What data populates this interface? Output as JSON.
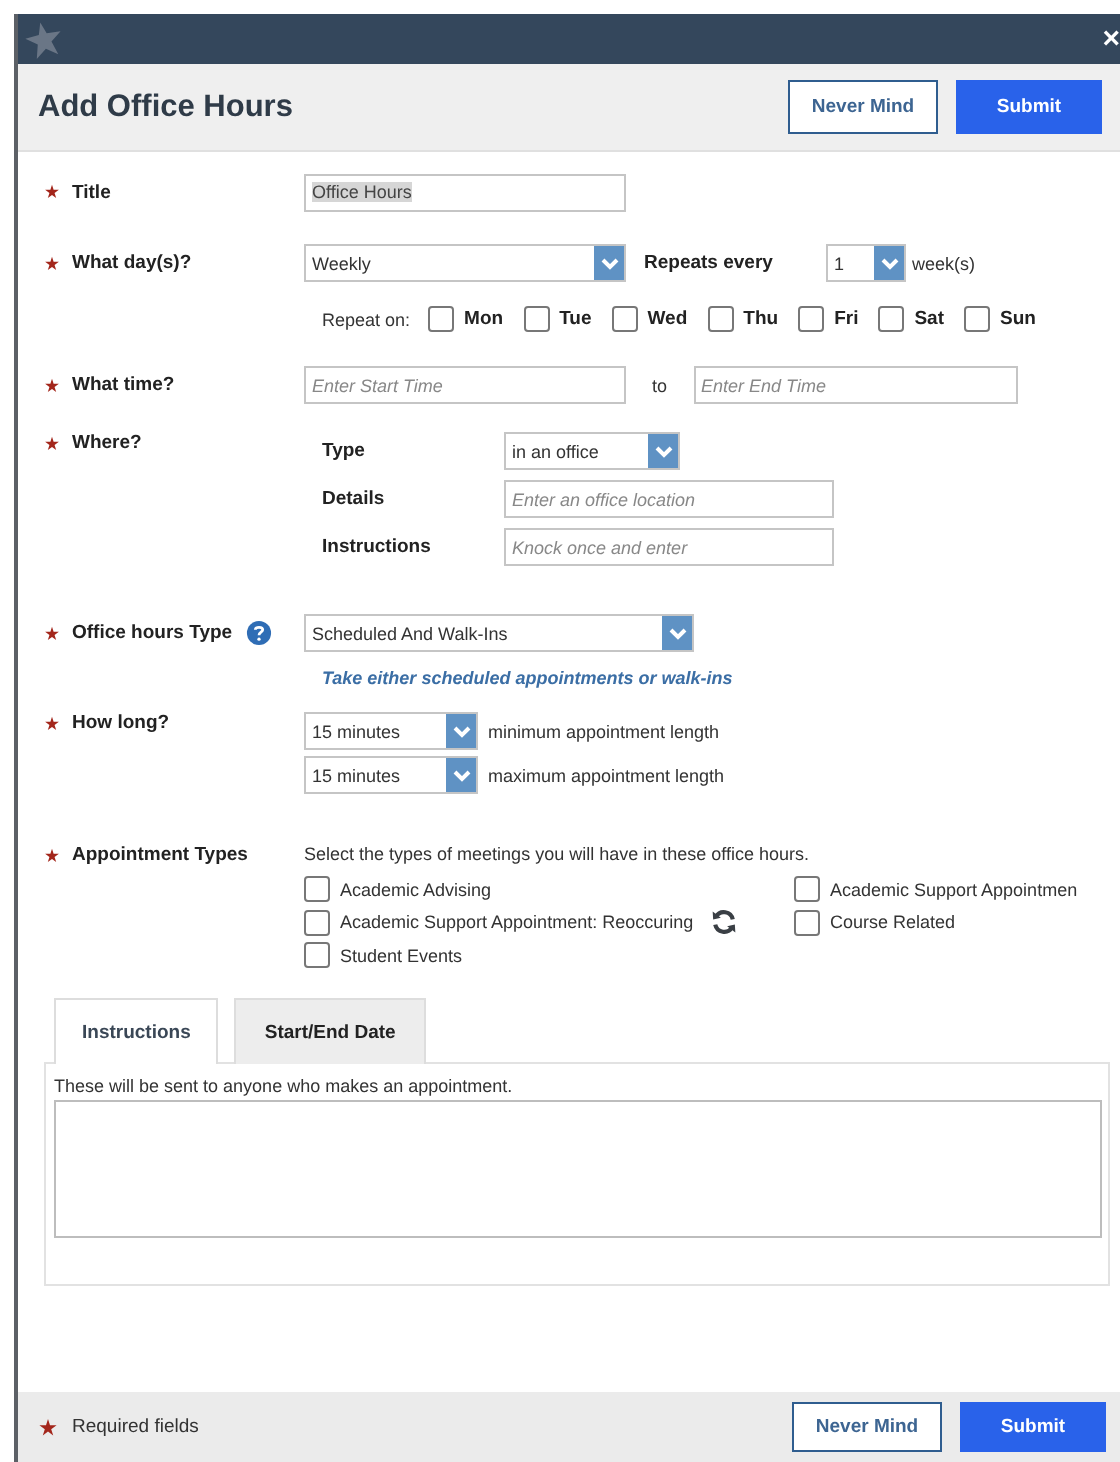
{
  "window": {
    "close": "×"
  },
  "header": {
    "title": "Add Office Hours",
    "buttons": [
      {
        "label": "Never Mind",
        "kind": "secondary"
      },
      {
        "label": "Submit",
        "kind": "primary"
      }
    ]
  },
  "title_field": {
    "label": "Title",
    "required": true,
    "value": "Office Hours"
  },
  "days": {
    "label": "What day(s)?",
    "required": true,
    "value": "Weekly",
    "repeats_label": "Repeats every",
    "repeats_value": "1",
    "unit": "week(s)",
    "repeat_on_label": "Repeat on:",
    "weekdays": [
      {
        "label": "Mon",
        "checked": false
      },
      {
        "label": "Tue",
        "checked": false
      },
      {
        "label": "Wed",
        "checked": false
      },
      {
        "label": "Thu",
        "checked": false
      },
      {
        "label": "Fri",
        "checked": false
      },
      {
        "label": "Sat",
        "checked": false
      },
      {
        "label": "Sun",
        "checked": false
      }
    ]
  },
  "time": {
    "label": "What time?",
    "required": true,
    "start_placeholder": "Enter Start Time",
    "separator": "to",
    "end_placeholder": "Enter End Time"
  },
  "where": {
    "label": "Where?",
    "required": true,
    "rows": [
      {
        "kind": "select",
        "label": "Type",
        "value": "in an office"
      },
      {
        "kind": "input",
        "label": "Details",
        "placeholder": "Enter an office location"
      },
      {
        "kind": "input",
        "label": "Instructions",
        "placeholder": "Knock once and enter"
      }
    ]
  },
  "office_hours_type": {
    "label": "Office hours Type",
    "required": true,
    "value": "Scheduled And Walk-Ins",
    "hint": "Take either scheduled appointments or walk-ins"
  },
  "how_long": {
    "label": "How long?",
    "required": true,
    "options": [
      {
        "value": "15 minutes",
        "caption": "minimum appointment length"
      },
      {
        "value": "15 minutes",
        "caption": "maximum appointment length"
      }
    ]
  },
  "appointment_types": {
    "label": "Appointment Types",
    "required": true,
    "description": "Select the types of meetings you will have in these office hours.",
    "items": [
      {
        "label": "Academic Advising",
        "checked": false,
        "recurring": false
      },
      {
        "label": "Academic Support Appointmen",
        "checked": false,
        "recurring": false
      },
      {
        "label": "Academic Support Appointment: Reoccuring",
        "checked": false,
        "recurring": true
      },
      {
        "label": "Course Related",
        "checked": false,
        "recurring": false
      },
      {
        "label": "Student Events",
        "checked": false,
        "recurring": false
      }
    ]
  },
  "tabs": [
    {
      "label": "Instructions",
      "selected": true
    },
    {
      "label": "Start/End Date",
      "selected": false
    }
  ],
  "tab_panel": {
    "note": "These will be sent to anyone who makes an appointment."
  },
  "footer": {
    "required_note": "Required fields",
    "buttons": [
      {
        "label": "Never Mind",
        "kind": "secondary"
      },
      {
        "label": "Submit",
        "kind": "primary"
      }
    ]
  }
}
